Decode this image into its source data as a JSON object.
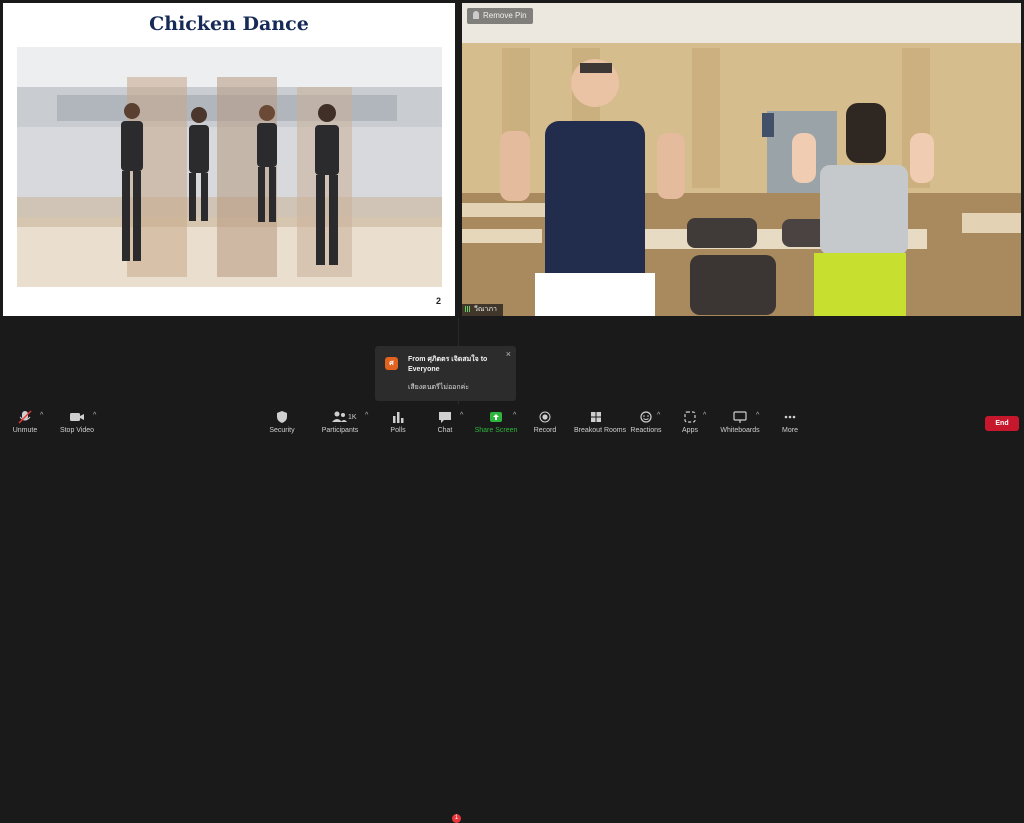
{
  "slide": {
    "title": "Chicken Dance",
    "page_number": "2"
  },
  "camera": {
    "pin_label": "Remove Pin",
    "participant_name": "วีณาภา"
  },
  "chat_notification": {
    "from_text": "From ศุภิตตร เจิดสมใจ to Everyone",
    "avatar_initial": "ศ",
    "message": "เสียงดนตรีไม่ออกค่ะ",
    "close_symbol": "×"
  },
  "toolbar": {
    "unmute": "Unmute",
    "stop_video": "Stop Video",
    "security": "Security",
    "participants": "Participants",
    "participants_count": "1K",
    "polls": "Polls",
    "chat": "Chat",
    "chat_badge": "1",
    "share_screen": "Share Screen",
    "record": "Record",
    "breakout_rooms": "Breakout Rooms",
    "reactions": "Reactions",
    "apps": "Apps",
    "whiteboards": "Whiteboards",
    "more": "More",
    "end": "End"
  },
  "colors": {
    "accent_end": "#c6172c",
    "share_green": "#2db53c",
    "chat_badge": "#e8363a",
    "avatar_orange": "#e2621f",
    "slide_title": "#152a57"
  }
}
